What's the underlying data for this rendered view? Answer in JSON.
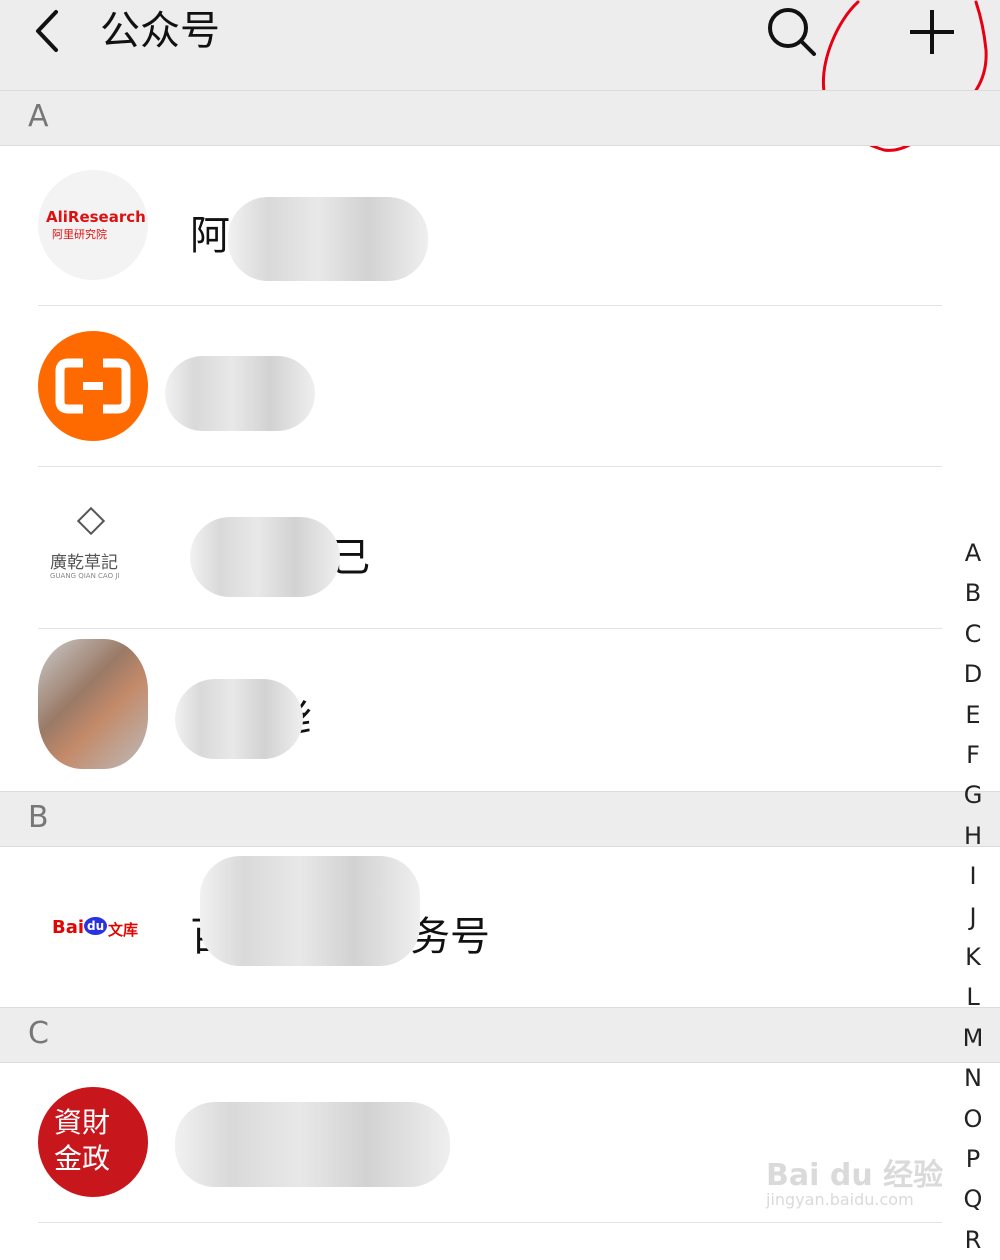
{
  "header": {
    "title": "公众号"
  },
  "sections": [
    "A",
    "B",
    "C"
  ],
  "accounts": [
    {
      "name_visible": "阿",
      "logo_text": "AliResearch",
      "logo_sub": "阿里研究院"
    },
    {
      "name_visible": "",
      "logo_text": "(-)"
    },
    {
      "name_visible": "己",
      "logo_text": "廣乾草記",
      "logo_sub": "GUANG QIAN CAO JI"
    },
    {
      "name_visible": "纟",
      "logo_text": ""
    },
    {
      "name_visible_left": "百",
      "name_visible_right": "务号",
      "logo_text": "Bai",
      "logo_text2": "du",
      "logo_text3": "文库"
    },
    {
      "name_visible": "",
      "logo_text": "資財\n金政"
    }
  ],
  "index_letters": [
    "A",
    "B",
    "C",
    "D",
    "E",
    "F",
    "G",
    "H",
    "I",
    "J",
    "K",
    "L",
    "M",
    "N",
    "O",
    "P",
    "Q",
    "R"
  ],
  "watermark": {
    "main": "Bai du 经验",
    "sub": "jingyan.baidu.com"
  },
  "colors": {
    "accent_orange": "#ff6a00",
    "baidu_red": "#e10601",
    "baidu_blue": "#2932e1",
    "annotation_red": "#e60012"
  }
}
